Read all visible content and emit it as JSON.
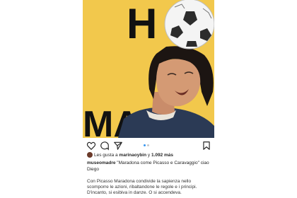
{
  "poster": {
    "letter_top": "H",
    "letters_bottom": "MA"
  },
  "colors": {
    "poster_bg": "#f2c84c",
    "dot_active": "#3897f0",
    "dot_inactive": "#c7c7c7"
  },
  "actions": {
    "icons": [
      "heart-icon",
      "comment-icon",
      "share-icon",
      "bookmark-icon"
    ],
    "carousel_dots": 2,
    "carousel_active": 0
  },
  "likes": {
    "prefix": "Les gusta a ",
    "user": "marinaoybin",
    "connector": " y ",
    "count": "1.092 más"
  },
  "caption": {
    "author": "museomadre",
    "text": " \"Maradona come Picasso e Caravaggio\" ciao Diego"
  },
  "body": {
    "text": "Con Picasso Maradona condivide la sapienza nello scomporre le azioni, ribaltandone le regole e i principi. D'incanto, si esibiva in danze. O si accendeva."
  }
}
